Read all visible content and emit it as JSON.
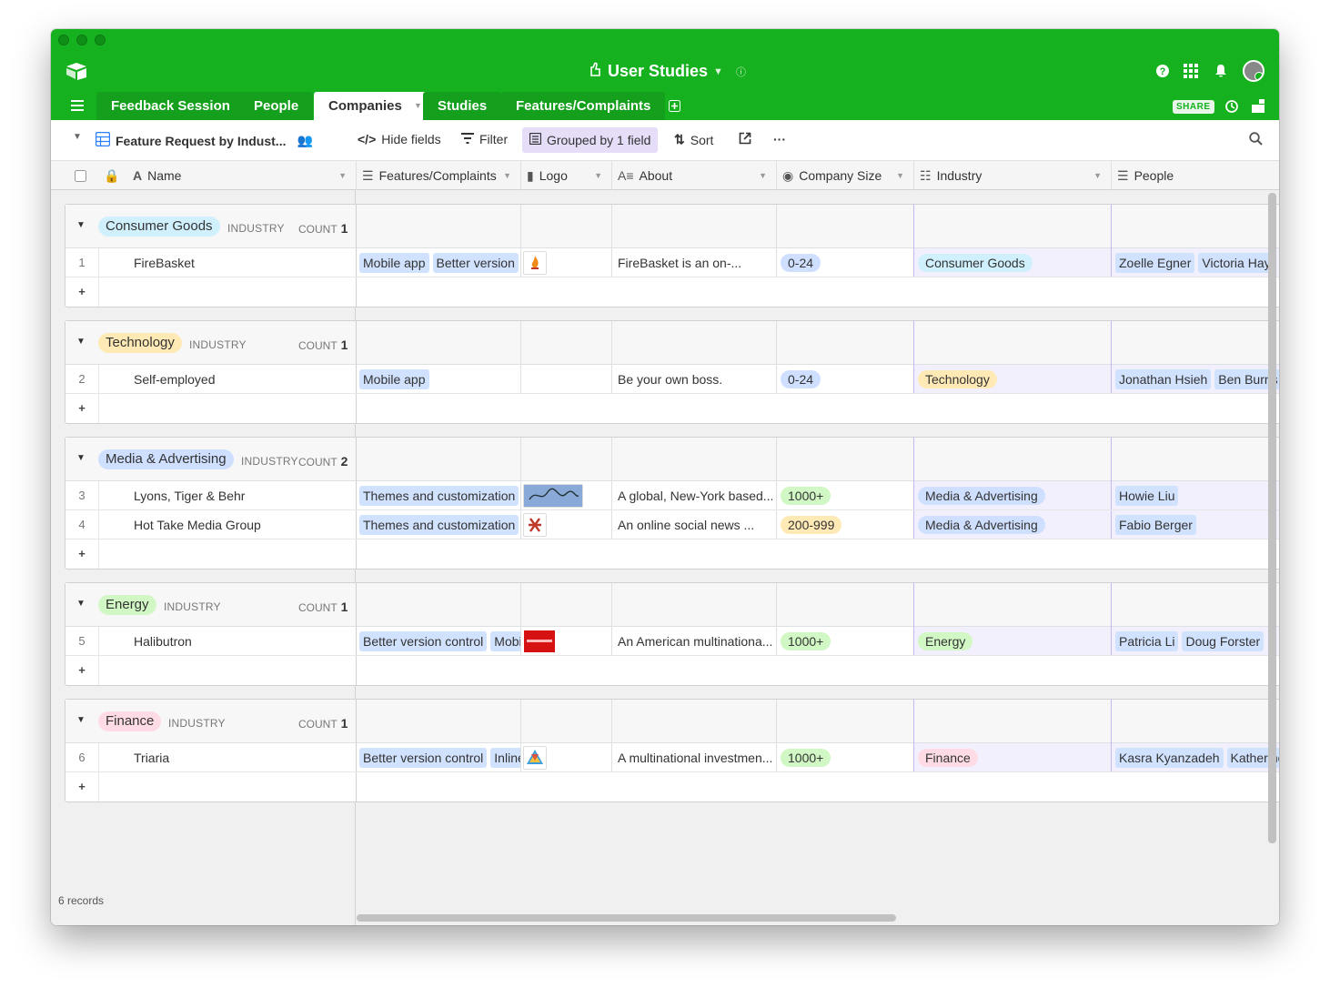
{
  "app": {
    "base_name": "User Studies",
    "share_label": "SHARE"
  },
  "colors": {
    "header_green": "#16b11f",
    "chip_blue": "#d1e2ff",
    "group_highlight": "#e6def8"
  },
  "tabs": [
    {
      "label": "Feedback Session"
    },
    {
      "label": "People"
    },
    {
      "label": "Companies"
    },
    {
      "label": "Studies"
    },
    {
      "label": "Features/Complaints"
    }
  ],
  "view": {
    "name": "Feature Request by Indust...",
    "hide_fields": "Hide fields",
    "filter": "Filter",
    "grouped": "Grouped by 1 field",
    "sort": "Sort"
  },
  "columns": {
    "name": "Name",
    "features": "Features/Complaints",
    "logo": "Logo",
    "about": "About",
    "size": "Company Size",
    "industry": "Industry",
    "people": "People"
  },
  "groups": [
    {
      "label": "Consumer Goods",
      "tag": "INDUSTRY",
      "count_label": "COUNT",
      "count": "1",
      "color": "#d0f0fd",
      "rows": [
        {
          "num": "1",
          "name": "FireBasket",
          "features": [
            "Mobile app",
            "Better version"
          ],
          "logo": "flame",
          "about": "FireBasket is an on-...",
          "size": "0-24",
          "size_color": "#cfdfff",
          "industry": "Consumer Goods",
          "industry_color": "#d0f0fd",
          "people": [
            "Zoelle Egner",
            "Victoria Hay"
          ]
        }
      ]
    },
    {
      "label": "Technology",
      "tag": "INDUSTRY",
      "count_label": "COUNT",
      "count": "1",
      "color": "#ffeab6",
      "rows": [
        {
          "num": "2",
          "name": "Self-employed",
          "features": [
            "Mobile app"
          ],
          "logo": "",
          "about": "Be your own boss.",
          "size": "0-24",
          "size_color": "#cfdfff",
          "industry": "Technology",
          "industry_color": "#ffeab6",
          "people": [
            "Jonathan Hsieh",
            "Ben Burns"
          ]
        }
      ]
    },
    {
      "label": "Media & Advertising",
      "tag": "INDUSTRY",
      "count_label": "COUNT",
      "count": "2",
      "color": "#cfdfff",
      "rows": [
        {
          "num": "3",
          "name": "Lyons, Tiger & Behr",
          "features": [
            "Themes and customization"
          ],
          "logo": "lyons",
          "about": "A global, New-York based...",
          "size": "1000+",
          "size_color": "#d1f7c4",
          "industry": "Media & Advertising",
          "industry_color": "#cfdfff",
          "people": [
            "Howie Liu"
          ]
        },
        {
          "num": "4",
          "name": "Hot Take Media Group",
          "features": [
            "Themes and customization"
          ],
          "logo": "hottake",
          "about": "An online social news ...",
          "size": "200-999",
          "size_color": "#ffeab6",
          "industry": "Media & Advertising",
          "industry_color": "#cfdfff",
          "people": [
            "Fabio Berger"
          ]
        }
      ]
    },
    {
      "label": "Energy",
      "tag": "INDUSTRY",
      "count_label": "COUNT",
      "count": "1",
      "color": "#d1f7c4",
      "rows": [
        {
          "num": "5",
          "name": "Halibutron",
          "features": [
            "Better version control",
            "Mobile app"
          ],
          "logo": "halibutron",
          "about": "An American multinationa...",
          "size": "1000+",
          "size_color": "#d1f7c4",
          "industry": "Energy",
          "industry_color": "#d1f7c4",
          "people": [
            "Patricia Li",
            "Doug Forster"
          ]
        }
      ]
    },
    {
      "label": "Finance",
      "tag": "INDUSTRY",
      "count_label": "COUNT",
      "count": "1",
      "color": "#ffdce5",
      "rows": [
        {
          "num": "6",
          "name": "Triaria",
          "features": [
            "Better version control",
            "Inline"
          ],
          "logo": "triaria",
          "about": "A multinational investmen...",
          "size": "1000+",
          "size_color": "#d1f7c4",
          "industry": "Finance",
          "industry_color": "#ffdce5",
          "people": [
            "Kasra Kyanzadeh",
            "Katherine"
          ]
        }
      ]
    }
  ],
  "footer": {
    "records": "6 records"
  },
  "add_row_symbol": "+"
}
